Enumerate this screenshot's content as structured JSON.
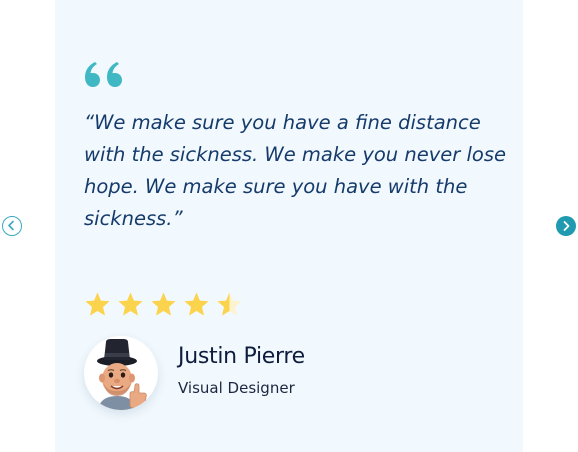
{
  "testimonial": {
    "quote": "“We make sure you have a fine distance with the sickness. We make you never lose hope. We make sure you have with the sickness.”",
    "rating": 4.5,
    "rating_max": 5,
    "author": {
      "name": "Justin Pierre",
      "role": "Visual Designer",
      "avatar_icon": "memoji-avatar-icon"
    }
  },
  "colors": {
    "card_bg": "#f1f9fe",
    "quote_mark": "#3fb8c4",
    "quote_text": "#163b6b",
    "star": "#fcd34d",
    "nav_accent": "#1f9ab0"
  },
  "icons": {
    "quote": "quote-mark-icon",
    "prev": "chevron-left-icon",
    "next": "chevron-right-icon",
    "star": "star-icon"
  }
}
